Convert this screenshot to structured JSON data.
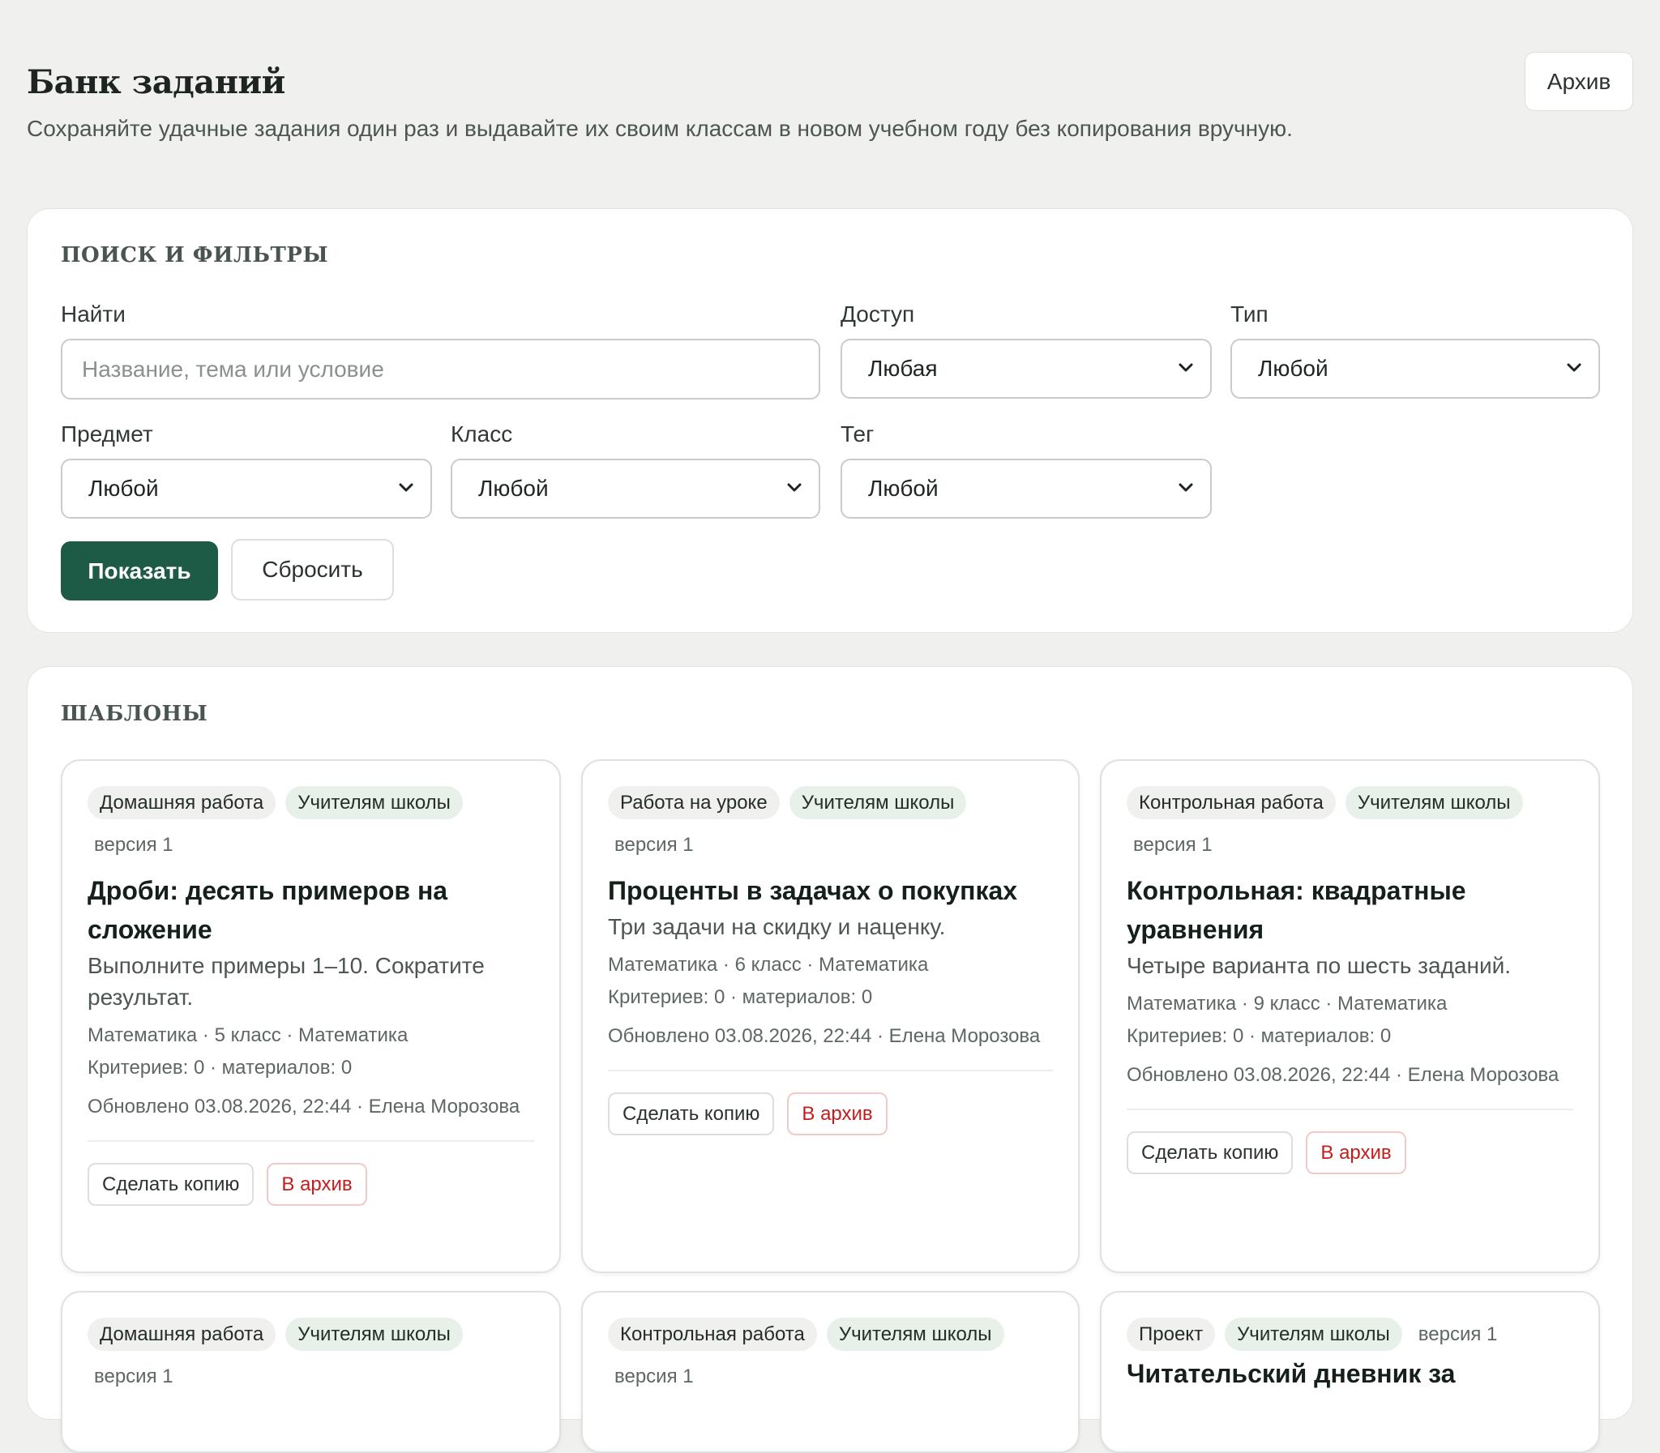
{
  "header": {
    "title": "Банк заданий",
    "subtitle": "Сохраняйте удачные задания один раз и выдавайте их своим классам в новом учебном году без копирования вручную.",
    "archive_button": "Архив"
  },
  "filters": {
    "heading": "ПОИСК И ФИЛЬТРЫ",
    "search": {
      "label": "Найти",
      "placeholder": "Название, тема или условие",
      "value": ""
    },
    "access": {
      "label": "Доступ",
      "value": "Любая"
    },
    "type": {
      "label": "Тип",
      "value": "Любой"
    },
    "subject": {
      "label": "Предмет",
      "value": "Любой"
    },
    "grade": {
      "label": "Класс",
      "value": "Любой"
    },
    "tag": {
      "label": "Тег",
      "value": "Любой"
    },
    "show_button": "Показать",
    "reset_button": "Сбросить"
  },
  "templates": {
    "heading": "ШАБЛОНЫ",
    "cards": [
      {
        "type": "Домашняя работа",
        "access": "Учителям школы",
        "version": "версия 1",
        "title": "Дроби: десять примеров на сложение",
        "description": "Выполните примеры 1–10. Сократите результат.",
        "meta": "Математика · 5 класс · Математика",
        "counts": "Критериев: 0 · материалов: 0",
        "updated": "Обновлено 03.08.2026, 22:44 · Елена Морозова",
        "copy_button": "Сделать копию",
        "archive_button": "В архив"
      },
      {
        "type": "Работа на уроке",
        "access": "Учителям школы",
        "version": "версия 1",
        "title": "Проценты в задачах о покупках",
        "description": "Три задачи на скидку и наценку.",
        "meta": "Математика · 6 класс · Математика",
        "counts": "Критериев: 0 · материалов: 0",
        "updated": "Обновлено 03.08.2026, 22:44 · Елена Морозова",
        "copy_button": "Сделать копию",
        "archive_button": "В архив"
      },
      {
        "type": "Контрольная работа",
        "access": "Учителям школы",
        "version": "версия 1",
        "title": "Контрольная: квадратные уравнения",
        "description": "Четыре варианта по шесть заданий.",
        "meta": "Математика · 9 класс · Математика",
        "counts": "Критериев: 0 · материалов: 0",
        "updated": "Обновлено 03.08.2026, 22:44 · Елена Морозова",
        "copy_button": "Сделать копию",
        "archive_button": "В архив"
      },
      {
        "type": "Домашняя работа",
        "access": "Учителям школы",
        "version": "версия 1",
        "title": "",
        "description": "",
        "meta": "",
        "counts": "",
        "updated": "",
        "copy_button": "",
        "archive_button": ""
      },
      {
        "type": "Контрольная работа",
        "access": "Учителям школы",
        "version": "версия 1",
        "title": "",
        "description": "",
        "meta": "",
        "counts": "",
        "updated": "",
        "copy_button": "",
        "archive_button": ""
      },
      {
        "type": "Проект",
        "access": "Учителям школы",
        "version": "версия 1",
        "title": "Читательский дневник за",
        "description": "",
        "meta": "",
        "counts": "",
        "updated": "",
        "copy_button": "",
        "archive_button": ""
      }
    ]
  }
}
